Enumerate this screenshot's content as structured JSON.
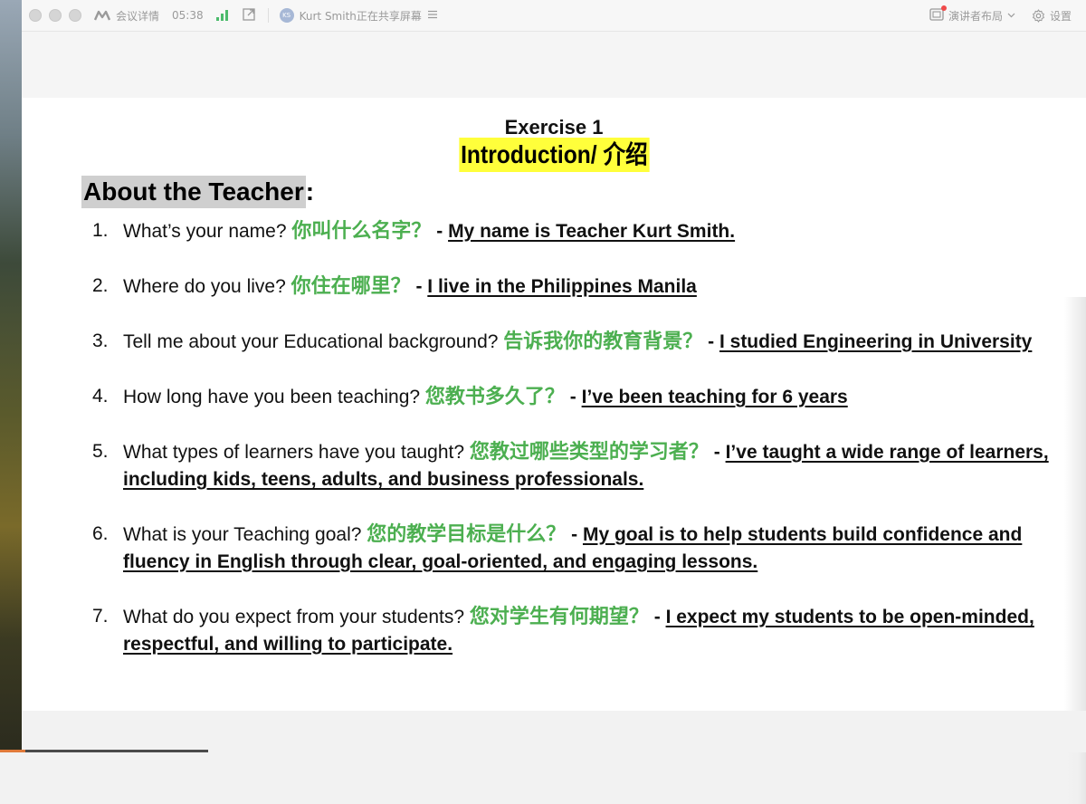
{
  "titlebar": {
    "meeting_details": "会议详情",
    "elapsed_time": "05:38",
    "presenter_avatar_initials": "KS",
    "sharing_status": "Kurt Smith正在共享屏幕",
    "layout_label": "演讲者布局",
    "settings_label": "设置",
    "colors": {
      "signal": "#4cbb6c",
      "notification_dot": "#f04a4a"
    }
  },
  "document": {
    "exercise_title": "Exercise 1",
    "intro_title": "Introduction/ 介绍",
    "section_heading": "About the Teacher",
    "section_heading_colon": ":",
    "highlight_color": "#ffff3b",
    "chinese_color": "#4caf50",
    "questions": [
      {
        "num": "1.",
        "en": "What’s your name? ",
        "cn": "你叫什么名字？",
        "dash": " - ",
        "answer": "My name is Teacher Kurt Smith."
      },
      {
        "num": "2.",
        "en": "Where do you live? ",
        "cn": "你住在哪里？",
        "dash": " - ",
        "answer": "I live in the Philippines Manila"
      },
      {
        "num": "3.",
        "en": "Tell me about your Educational background? ",
        "cn": "告诉我你的教育背景？",
        "dash": " - ",
        "answer": "I studied Engineering in University"
      },
      {
        "num": "4.",
        "en": "How long have you been teaching? ",
        "cn": "您教书多久了？",
        "dash": " - ",
        "answer": "I’ve been teaching for 6 years"
      },
      {
        "num": "5.",
        "en": "What types of learners have you taught? ",
        "cn": "您教过哪些类型的学习者？",
        "dash": " - ",
        "answer": "I’ve taught a wide range of learners, including kids, teens, adults, and business professionals."
      },
      {
        "num": "6.",
        "en": "What is your Teaching goal? ",
        "cn": "您的教学目标是什么？",
        "dash": " - ",
        "answer": "My goal is to help students build confidence and fluency in English through clear, goal-oriented, and engaging lessons."
      },
      {
        "num": "7.",
        "en": "What do you expect from your students? ",
        "cn": "您对学生有何期望？",
        "dash": " - ",
        "answer": "I expect my students to be open-minded, respectful, and willing to participate."
      }
    ]
  }
}
